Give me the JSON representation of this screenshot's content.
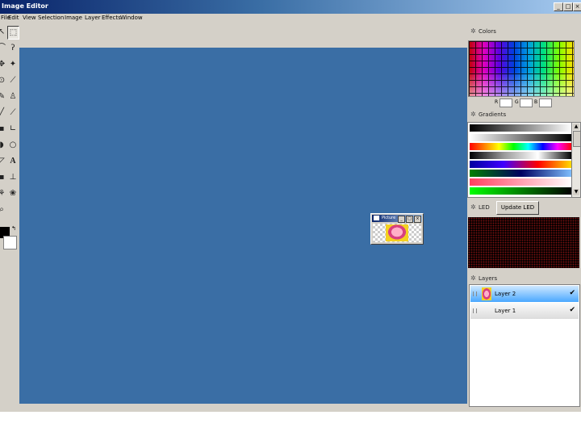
{
  "window": {
    "title": "Image Editor",
    "min_glyph": "_",
    "max_glyph": "□",
    "close_glyph": "×"
  },
  "menubar": {
    "items": [
      "File",
      "Edit",
      "View",
      "Selection",
      "Image",
      "Layer",
      "Effects",
      "Window"
    ]
  },
  "colors_panel": {
    "title": "Colors",
    "r_label": "R",
    "g_label": "G",
    "b_label": "B",
    "r_value": "",
    "g_value": "",
    "b_value": ""
  },
  "gradients_panel": {
    "title": "Gradients"
  },
  "led_panel": {
    "title": "LED",
    "update_button": "Update LED"
  },
  "layers_panel": {
    "title": "Layers",
    "rows": [
      {
        "name": "Layer 2",
        "check": "✔"
      },
      {
        "name": "Layer 1",
        "check": "✔"
      }
    ]
  },
  "mini_window": {
    "title": "Picture"
  },
  "tools": [
    "pointer-tool",
    "selection-tool",
    "lasso-tool",
    "magic-wand-tool",
    "move-tool",
    "eyedropper-tool",
    "pencil-tool",
    "stamp-tool",
    "brush-tool",
    "line-tool",
    "rectangle-tool",
    "ellipse-tool",
    "text-tool",
    "crop-tool",
    "fill-tool",
    "zoom-tool"
  ],
  "colors": {
    "accent": "#3a6ea5",
    "chrome": "#d4d0c8",
    "titlebar_start": "#0a246a"
  }
}
